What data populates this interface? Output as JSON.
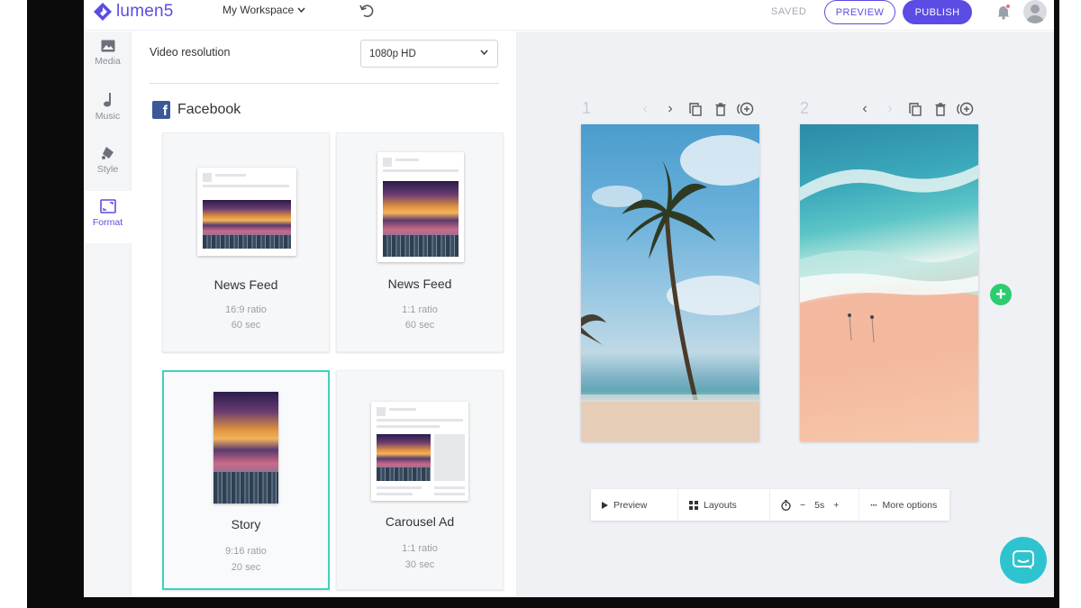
{
  "app": {
    "name": "lumen5",
    "workspace": "My Workspace",
    "brand_color": "#5b4ce3"
  },
  "header": {
    "saved_label": "SAVED",
    "preview_label": "PREVIEW",
    "publish_label": "PUBLISH"
  },
  "rail": {
    "items": [
      {
        "label": "Media",
        "icon": "image-icon"
      },
      {
        "label": "Music",
        "icon": "music-note-icon"
      },
      {
        "label": "Style",
        "icon": "paint-bucket-icon"
      },
      {
        "label": "Format",
        "icon": "format-frame-icon",
        "active": true
      }
    ]
  },
  "panel": {
    "resolution_label": "Video resolution",
    "resolution_value": "1080p HD",
    "platform": "Facebook",
    "formats": [
      {
        "title": "News Feed",
        "ratio": "16:9 ratio",
        "duration": "60 sec"
      },
      {
        "title": "News Feed",
        "ratio": "1:1 ratio",
        "duration": "60 sec"
      },
      {
        "title": "Story",
        "ratio": "9:16 ratio",
        "duration": "20 sec",
        "selected": true
      },
      {
        "title": "Carousel Ad",
        "ratio": "1:1 ratio",
        "duration": "30 sec"
      }
    ]
  },
  "canvas": {
    "scenes": [
      {
        "number": "1",
        "image": "palm-tree-beach"
      },
      {
        "number": "2",
        "image": "aerial-beach-waves"
      }
    ],
    "toolbar": {
      "preview_label": "Preview",
      "layouts_label": "Layouts",
      "duration_value": "5s",
      "minus": "−",
      "plus": "+",
      "more_label": "More options"
    }
  }
}
